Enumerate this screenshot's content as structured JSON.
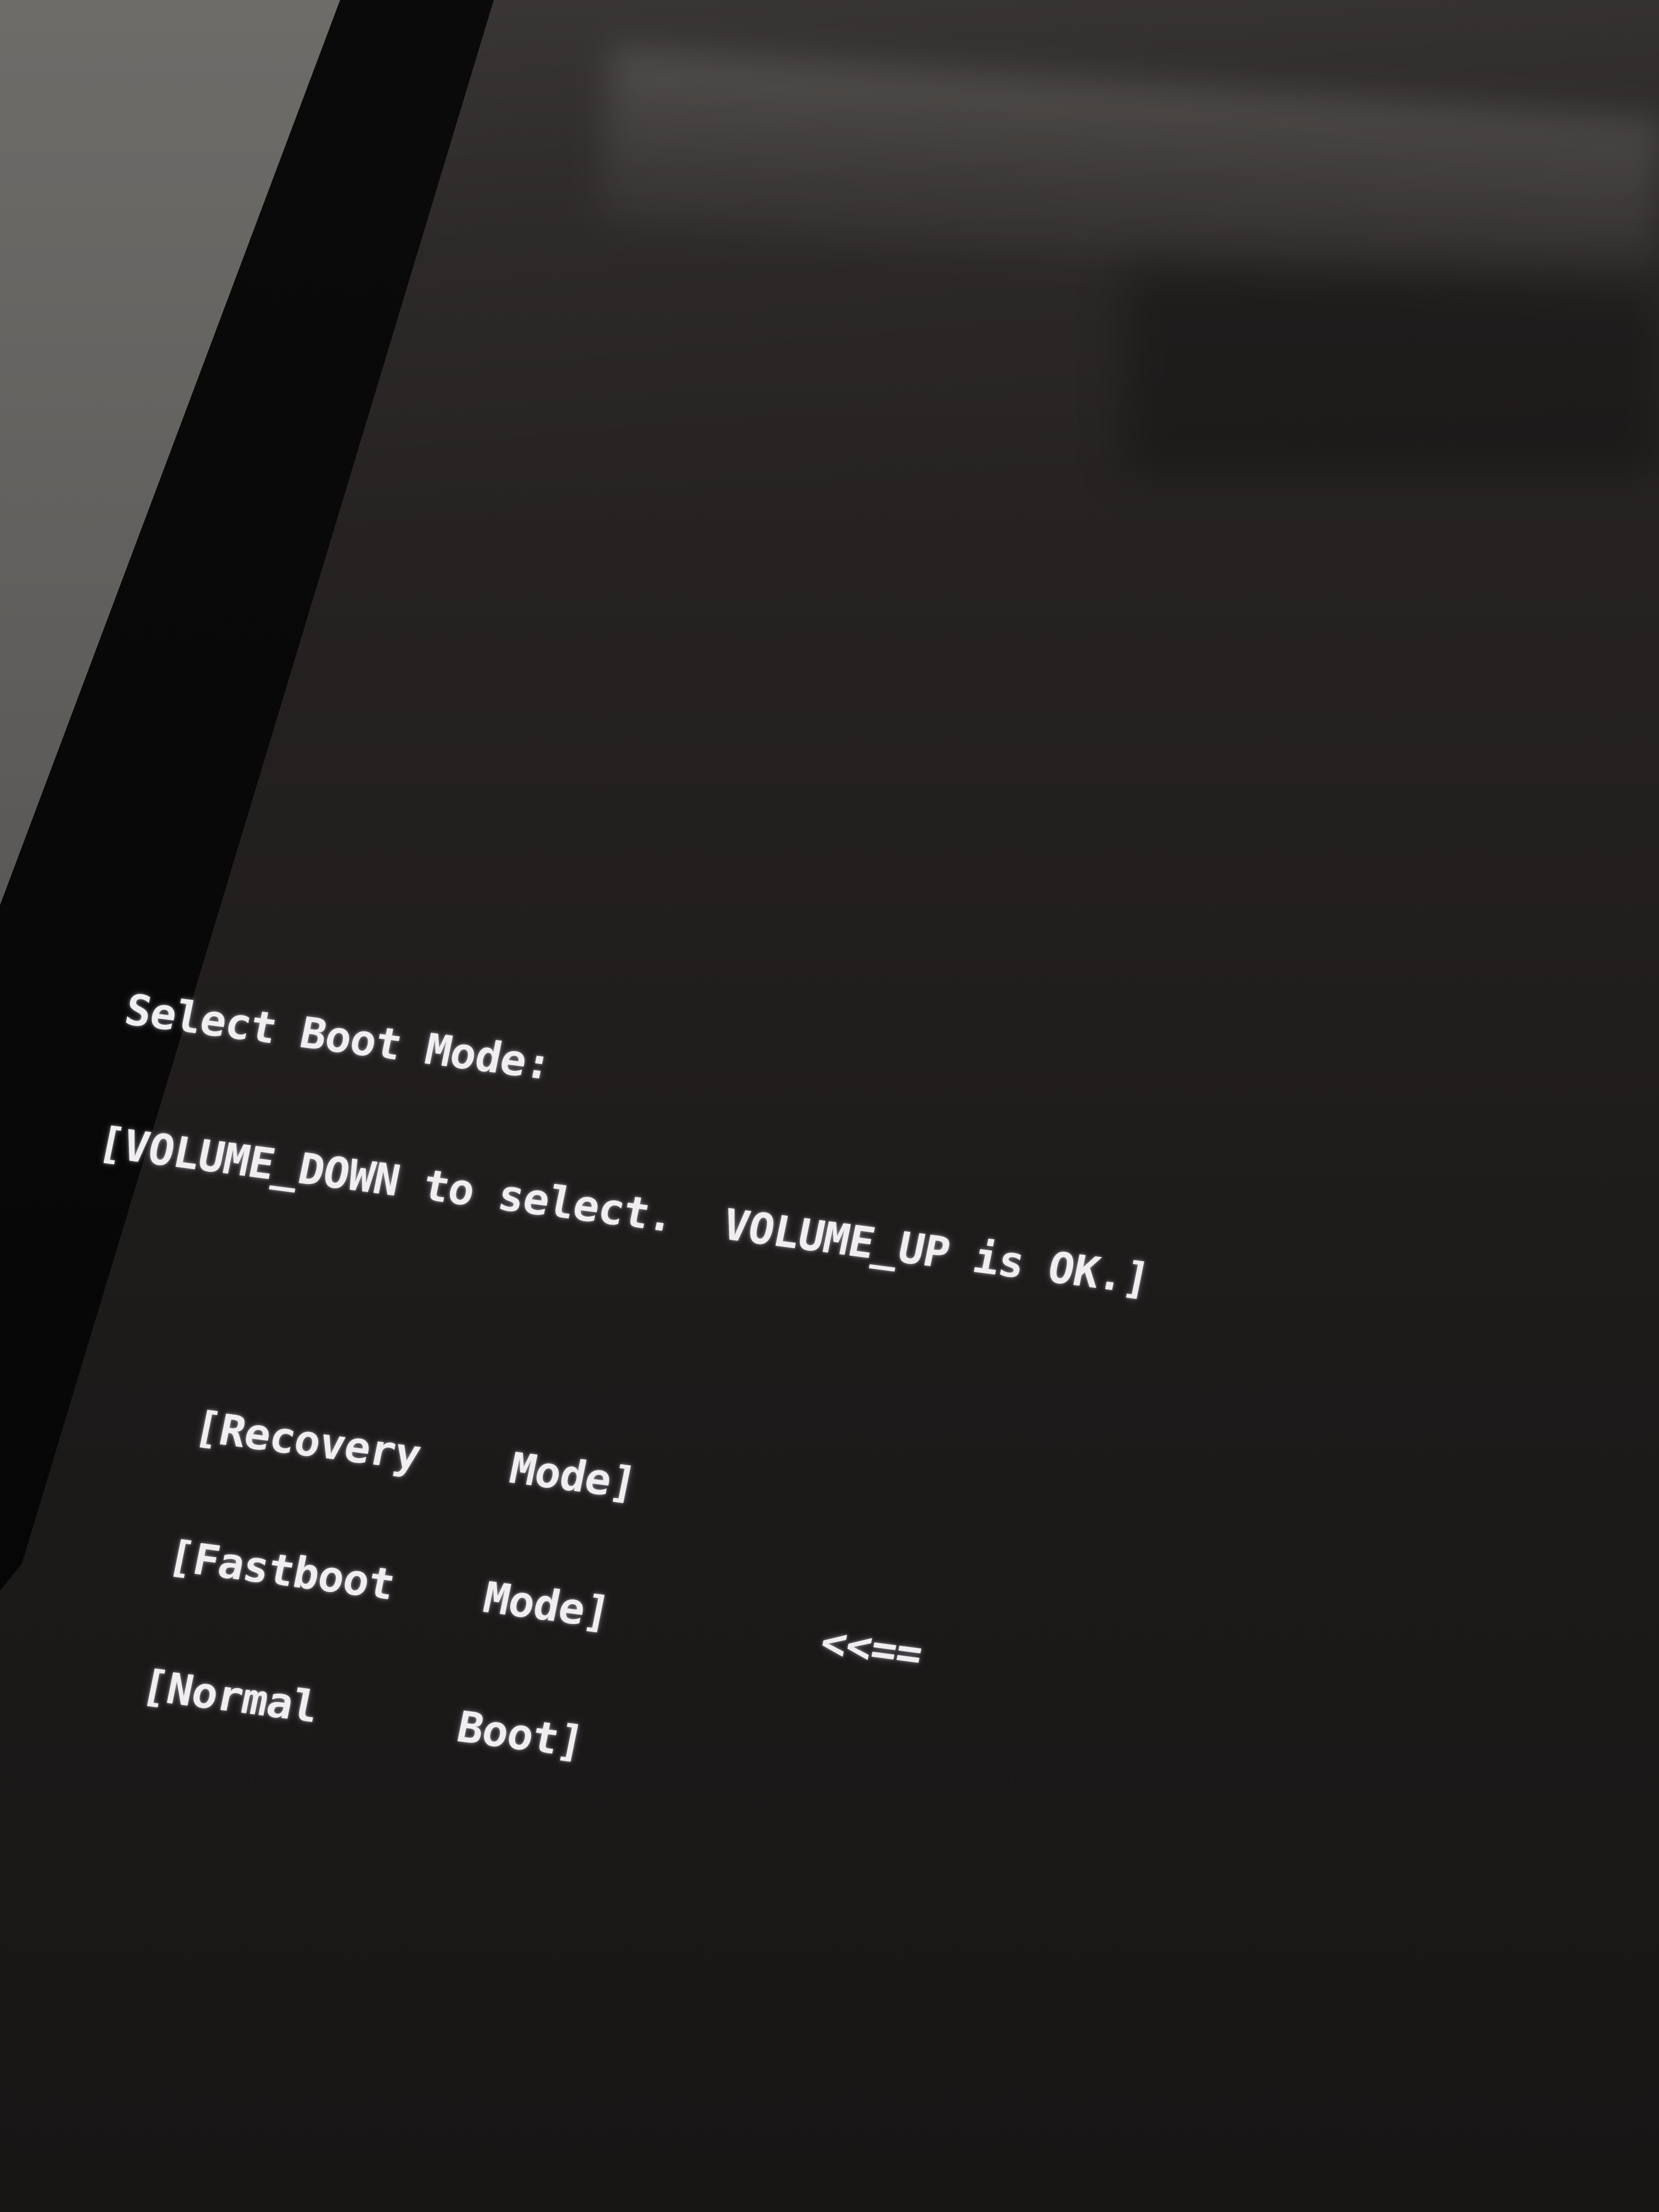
{
  "boot_menu": {
    "title": "Select Boot Mode:",
    "instructions": "[VOLUME_DOWN to select.  VOLUME_UP is OK.]",
    "options": [
      {
        "label": "[Recovery",
        "suffix": "Mode]",
        "selected": false
      },
      {
        "label": "[Fastboot",
        "suffix": "Mode]",
        "selected": true
      },
      {
        "label": "[Normal",
        "suffix": "Boot]",
        "selected": false
      }
    ],
    "selection_marker": "<<=="
  }
}
